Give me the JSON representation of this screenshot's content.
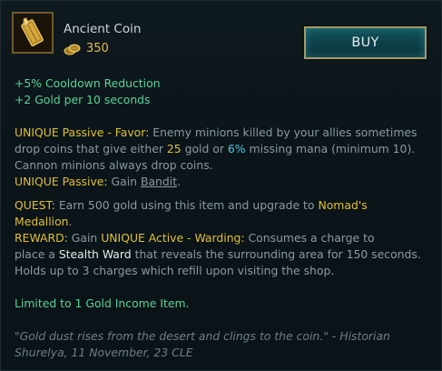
{
  "item": {
    "name": "Ancient Coin",
    "cost": "350",
    "icon": "ancient-coin-icon",
    "cost_icon": "gold-coins-icon"
  },
  "buy_label": "BUY",
  "stats": [
    "+5% Cooldown Reduction",
    "+2 Gold per 10 seconds"
  ],
  "passive_favor": {
    "tag": "UNIQUE Passive - Favor:",
    "text_1": " Enemy minions killed by your allies sometimes",
    "text_2": "drop coins that give either ",
    "gold_amount": "25",
    "text_3": " gold or ",
    "mana_percent": "6%",
    "text_4": " missing mana (minimum 10).",
    "text_5": "Cannon minions always drop coins."
  },
  "passive_bandit": {
    "tag": "UNIQUE Passive:",
    "text": " Gain ",
    "link": "Bandit",
    "end": "."
  },
  "quest": {
    "tag": "QUEST:",
    "text": " Earn 500 gold using this item and upgrade to ",
    "target": "Nomad's",
    "target_2": "Medallion",
    "end": "."
  },
  "reward": {
    "tag": "REWARD:",
    "text_1": " Gain ",
    "active_tag": "UNIQUE Active - Warding:",
    "text_2": " Consumes a charge to",
    "text_3": "place a ",
    "ward": "Stealth Ward",
    "text_4": " that reveals the surrounding area for 150 seconds.",
    "text_5": "Holds up to 3 charges which refill upon visiting the shop."
  },
  "limit": "Limited to 1 Gold Income Item.",
  "flavor": {
    "quote_1": "\"Gold dust rises from the desert and clings to the coin.\" - Historian",
    "quote_2": "Shurelya, 11 November, 23 CLE"
  },
  "colors": {
    "stat_green": "#58d39a",
    "unique_gold": "#e0c034",
    "blue_value": "#4fc7e6",
    "body_gray": "#8b9aa0",
    "buy_teal": "#0d3f48"
  }
}
